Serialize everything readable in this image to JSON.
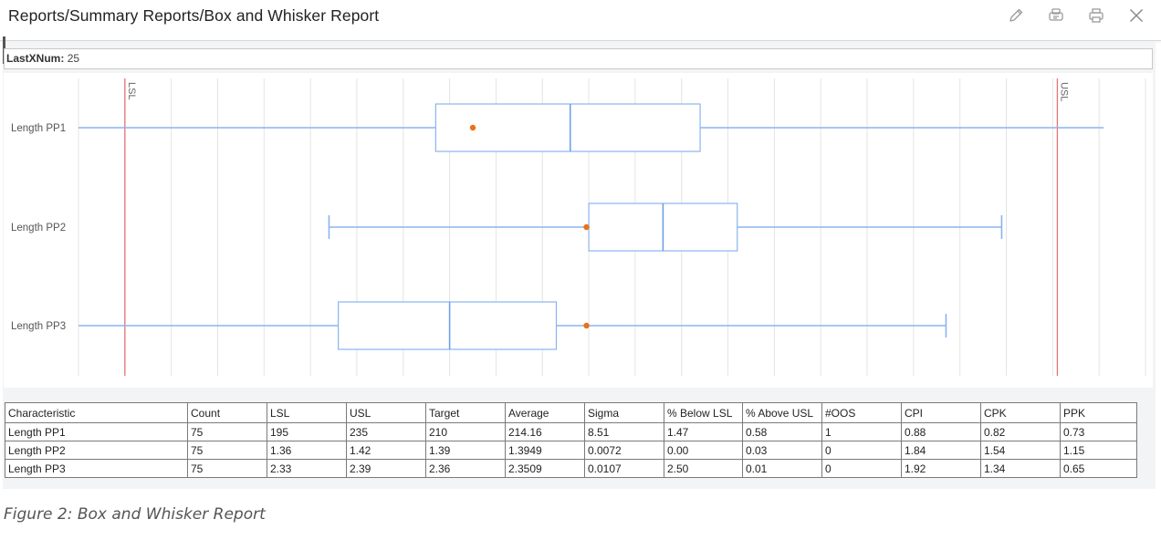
{
  "header": {
    "title": "Reports/Summary Reports/Box and Whisker Report",
    "icons": [
      "pencil-icon",
      "report-design-icon",
      "print-icon",
      "close-icon"
    ]
  },
  "filter": {
    "label": "LastXNum:",
    "value": "25"
  },
  "chart_data": {
    "type": "box",
    "categories": [
      "Length PP1",
      "Length PP2",
      "Length PP3"
    ],
    "xaxis": {
      "units": "index",
      "tick_count": 24
    },
    "spec_lines": [
      {
        "label": "LSL",
        "color": "#e57373"
      },
      {
        "label": "USL",
        "color": "#e57373"
      }
    ],
    "series": [
      {
        "category": "Length PP1",
        "whisker_low": 0.0,
        "q1": 7.7,
        "median": 10.6,
        "q3": 13.4,
        "whisker_high": 22.1,
        "mean": 8.5,
        "low_capped": false,
        "high_capped": false
      },
      {
        "category": "Length PP2",
        "whisker_low": 5.4,
        "q1": 11.0,
        "median": 12.6,
        "q3": 14.2,
        "whisker_high": 19.9,
        "mean": 10.95,
        "low_capped": true,
        "high_capped": true
      },
      {
        "category": "Length PP3",
        "whisker_low": 0.0,
        "q1": 5.6,
        "median": 8.0,
        "q3": 10.3,
        "whisker_high": 18.7,
        "mean": 10.95,
        "low_capped": false,
        "high_capped": true
      }
    ],
    "spec_positions": {
      "LSL": 1.0,
      "USL": 21.1
    },
    "colors": {
      "box": "#8ab4f0",
      "median": "#6fa0ea",
      "mean": "#e8731a",
      "grid": "#e4e4e4"
    }
  },
  "table": {
    "headers": [
      "Characteristic",
      "Count",
      "LSL",
      "USL",
      "Target",
      "Average",
      "Sigma",
      "% Below LSL",
      "% Above USL",
      "#OOS",
      "CPI",
      "CPK",
      "PPK"
    ],
    "rows": [
      [
        "Length PP1",
        "75",
        "195",
        "235",
        "210",
        "214.16",
        "8.51",
        "1.47",
        "0.58",
        "1",
        "0.88",
        "0.82",
        "0.73"
      ],
      [
        "Length PP2",
        "75",
        "1.36",
        "1.42",
        "1.39",
        "1.3949",
        "0.0072",
        "0.00",
        "0.03",
        "0",
        "1.84",
        "1.54",
        "1.15"
      ],
      [
        "Length PP3",
        "75",
        "2.33",
        "2.39",
        "2.36",
        "2.3509",
        "0.0107",
        "2.50",
        "0.01",
        "0",
        "1.92",
        "1.34",
        "0.65"
      ]
    ]
  },
  "caption": "Figure 2: Box and Whisker Report"
}
